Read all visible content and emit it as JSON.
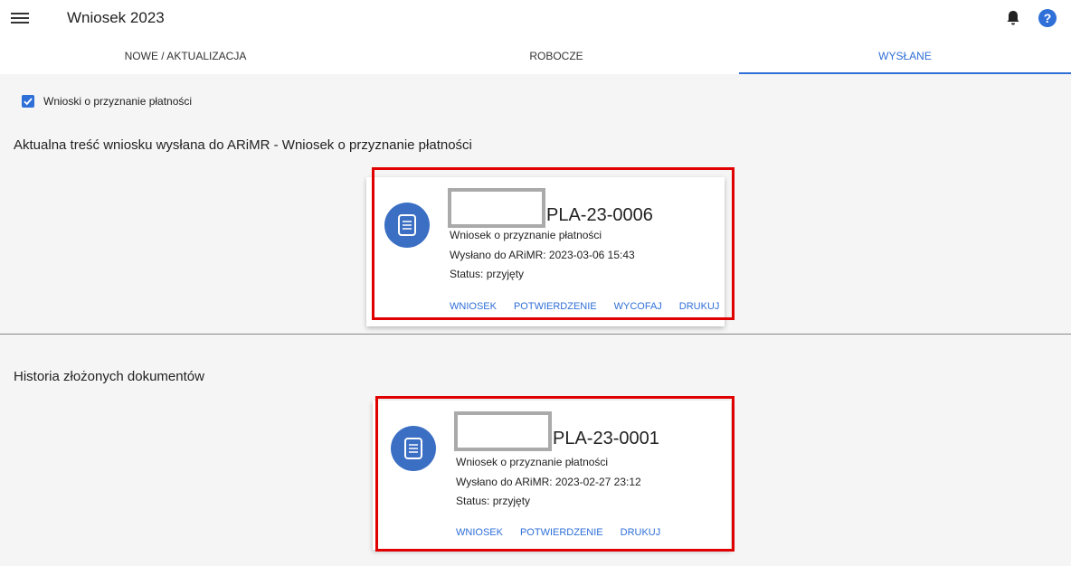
{
  "header": {
    "title": "Wniosek 2023"
  },
  "tabs": [
    {
      "label": "NOWE / AKTUALIZACJA"
    },
    {
      "label": "ROBOCZE"
    },
    {
      "label": "WYSŁANE"
    }
  ],
  "filter": {
    "label": "Wnioski o przyznanie płatności",
    "checked": true
  },
  "current": {
    "heading": "Aktualna treść wniosku wysłana do ARiMR - Wniosek o przyznanie płatności",
    "card": {
      "number": "PLA-23-0006",
      "type": "Wniosek o przyznanie płatności",
      "sent": "Wysłano do ARiMR: 2023-03-06 15:43",
      "status": "Status: przyjęty",
      "actions": [
        "WNIOSEK",
        "POTWIERDZENIE",
        "WYCOFAJ",
        "DRUKUJ"
      ]
    }
  },
  "history": {
    "heading": "Historia złożonych dokumentów",
    "card": {
      "number": "PLA-23-0001",
      "type": "Wniosek o przyznanie płatności",
      "sent": "Wysłano do ARiMR: 2023-02-27 23:12",
      "status": "Status: przyjęty",
      "actions": [
        "WNIOSEK",
        "POTWIERDZENIE",
        "DRUKUJ"
      ]
    }
  },
  "colors": {
    "accent": "#2f6fd8",
    "highlight": "#e00000",
    "icon_bg": "#3b6fc4"
  }
}
